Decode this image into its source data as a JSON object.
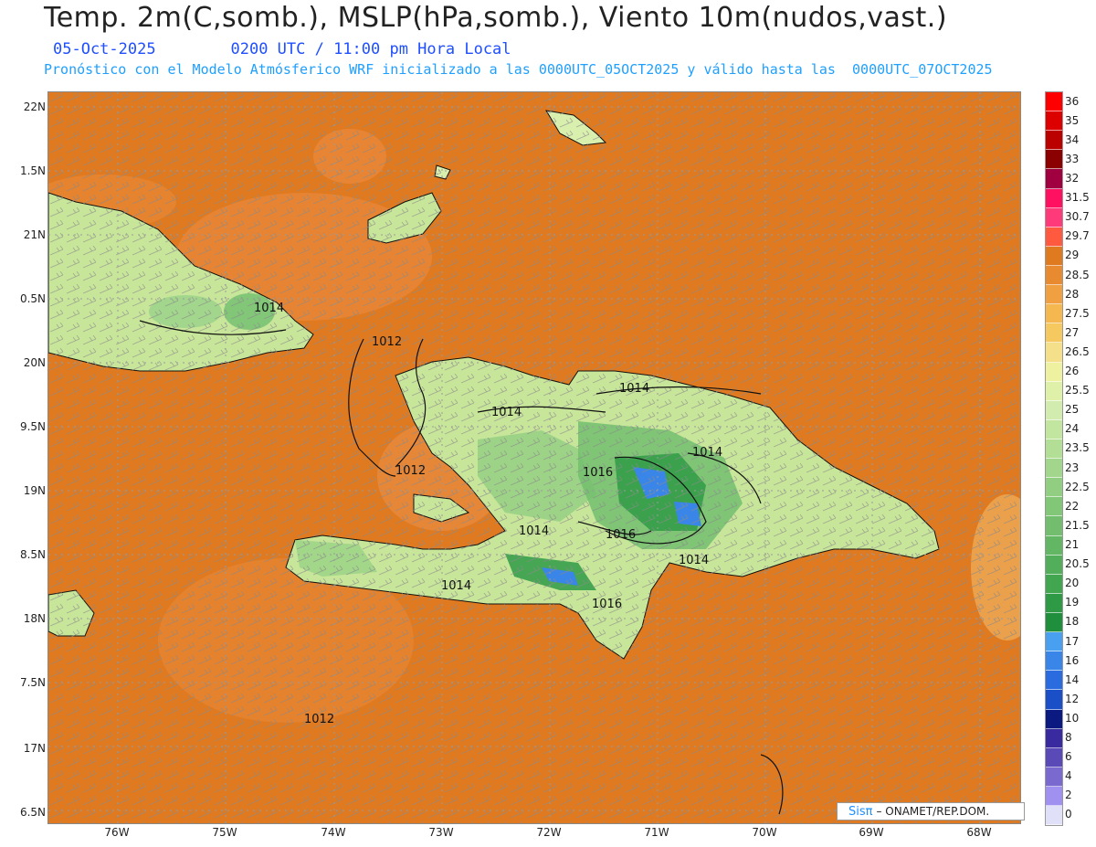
{
  "header": {
    "title": "Temp. 2m(C,somb.), MSLP(hPa,somb.), Viento 10m(nudos,vast.)",
    "date": "05-Oct-2025",
    "time": "0200 UTC / 11:00 pm Hora Local",
    "forecast_info": "Pronóstico con el Modelo Atmósferico WRF inicializado a las 0000UTC_05OCT2025 y válido hasta las  0000UTC_07OCT2025"
  },
  "map": {
    "latitude_labels": [
      "22N",
      "1.5N",
      "21N",
      "0.5N",
      "20N",
      "9.5N",
      "19N",
      "8.5N",
      "18N",
      "7.5N",
      "17N",
      "6.5N"
    ],
    "longitude_labels": [
      "76W",
      "75W",
      "74W",
      "73W",
      "72W",
      "71W",
      "70W",
      "69W",
      "68W"
    ],
    "isobar_labels": [
      "1012",
      "1012",
      "1012",
      "1014",
      "1014",
      "1014",
      "1014",
      "1014",
      "1014",
      "1014",
      "1016",
      "1016",
      "1016"
    ],
    "colors": {
      "sea": "#e07a20",
      "land_low": "#c8e69a",
      "land_mid": "#6fbf6f",
      "mountain": "#2f9a4a",
      "cold_peak": "#3a6fd8",
      "isobar": "#111111"
    }
  },
  "legend": {
    "values": [
      "36",
      "35",
      "34",
      "33",
      "32",
      "31.5",
      "30.7",
      "29.7",
      "29",
      "28.5",
      "28",
      "27.5",
      "27",
      "26.5",
      "26",
      "25.5",
      "25",
      "24",
      "23.5",
      "23",
      "22.5",
      "22",
      "21.5",
      "21",
      "20.5",
      "20",
      "19",
      "18",
      "17",
      "16",
      "14",
      "12",
      "10",
      "8",
      "6",
      "4",
      "2",
      "0"
    ],
    "colors": [
      "#ff0000",
      "#dd0000",
      "#bb0000",
      "#8b0000",
      "#a00040",
      "#ff1060",
      "#ff3a7a",
      "#ff5a40",
      "#e07a20",
      "#e88a30",
      "#f0a040",
      "#f5b850",
      "#f6c860",
      "#f4e08a",
      "#eef2a0",
      "#dff0a8",
      "#d2ecb0",
      "#c2e6a0",
      "#b2de96",
      "#a2d68c",
      "#92ce82",
      "#82c678",
      "#72be6e",
      "#62b664",
      "#52ae5a",
      "#42a650",
      "#2f9a46",
      "#1f8f3e",
      "#4aa0f0",
      "#3a86e8",
      "#2a6ce0",
      "#1a4fc8",
      "#0a1a80",
      "#3a2aa0",
      "#5a4ab8",
      "#7a6ad0",
      "#a090f0",
      "#e0e0f8"
    ]
  },
  "credit": {
    "brand": "Sisπ",
    "text": "– ONAMET/REP.DOM."
  }
}
